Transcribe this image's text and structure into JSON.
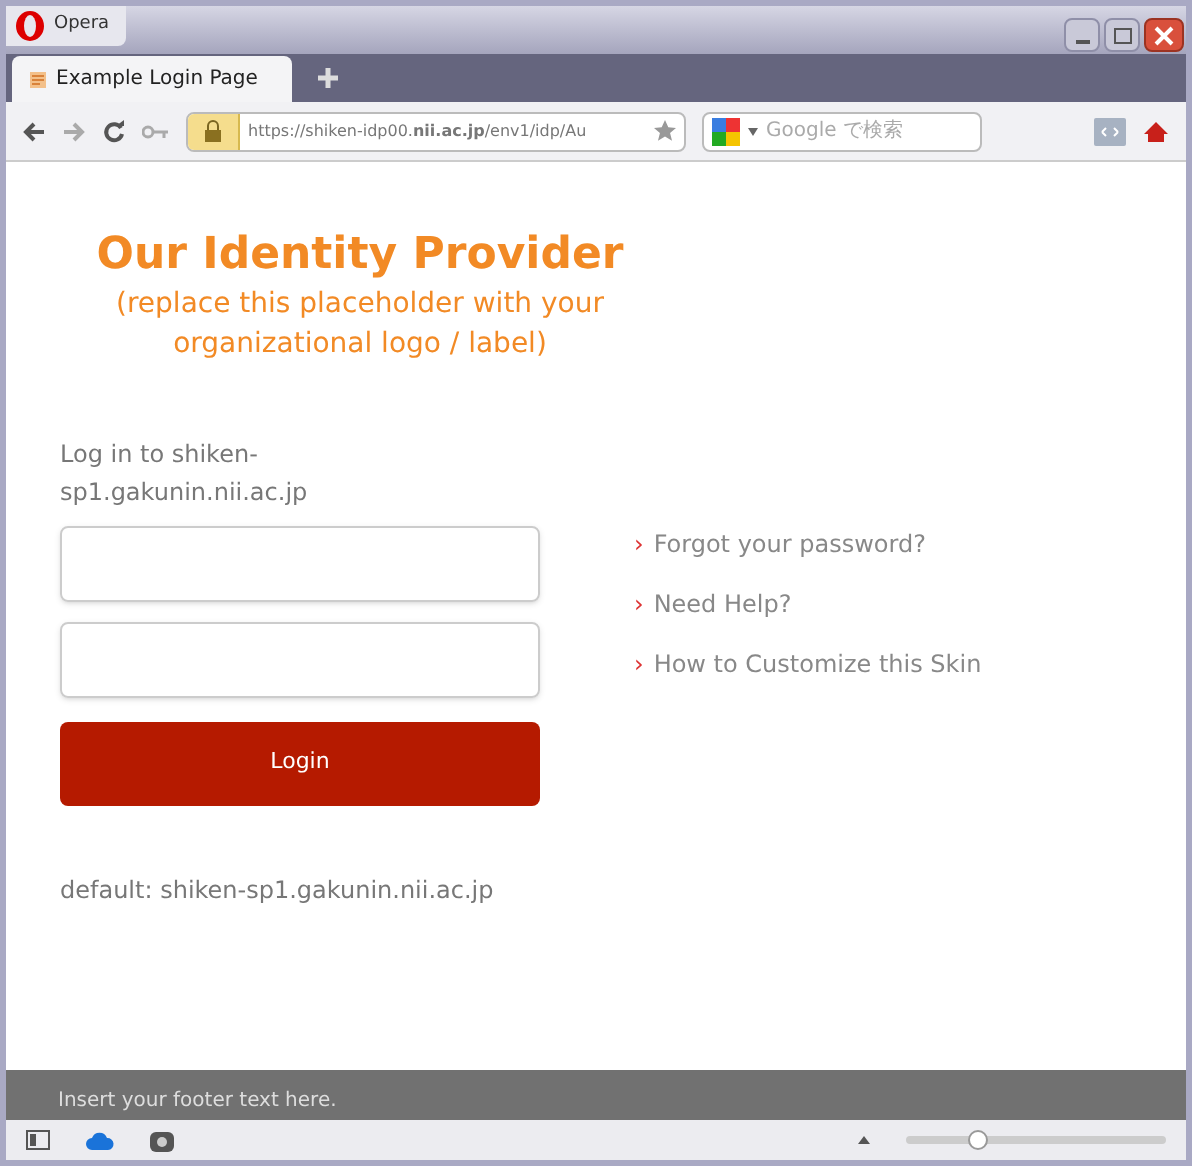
{
  "window": {
    "app_button": "Opera"
  },
  "tabs": [
    {
      "title": "Example Login Page",
      "selected": true
    }
  ],
  "address_bar": {
    "url": "https://shiken-idp00.**nii.ac.jp**/env1/idp/Au"
  },
  "search": {
    "placeholder": "Google で検索"
  },
  "page": {
    "heading": "Our Identity Provider",
    "subheading": "(replace this placeholder with your organizational logo / label)",
    "prompt": "Log in to shiken-sp1.gakunin.nii.ac.jp",
    "login_button": "Login",
    "default_note": "default: shiken-sp1.gakunin.nii.ac.jp",
    "links": [
      {
        "marker": "›",
        "label": "Forgot your password?"
      },
      {
        "marker": "›",
        "label": "Need Help?"
      },
      {
        "marker": "›",
        "label": "How to Customize this Skin"
      }
    ],
    "footer": "Insert your footer text here."
  },
  "status_bar": {
    "zoom": {
      "level": 0.28
    }
  }
}
